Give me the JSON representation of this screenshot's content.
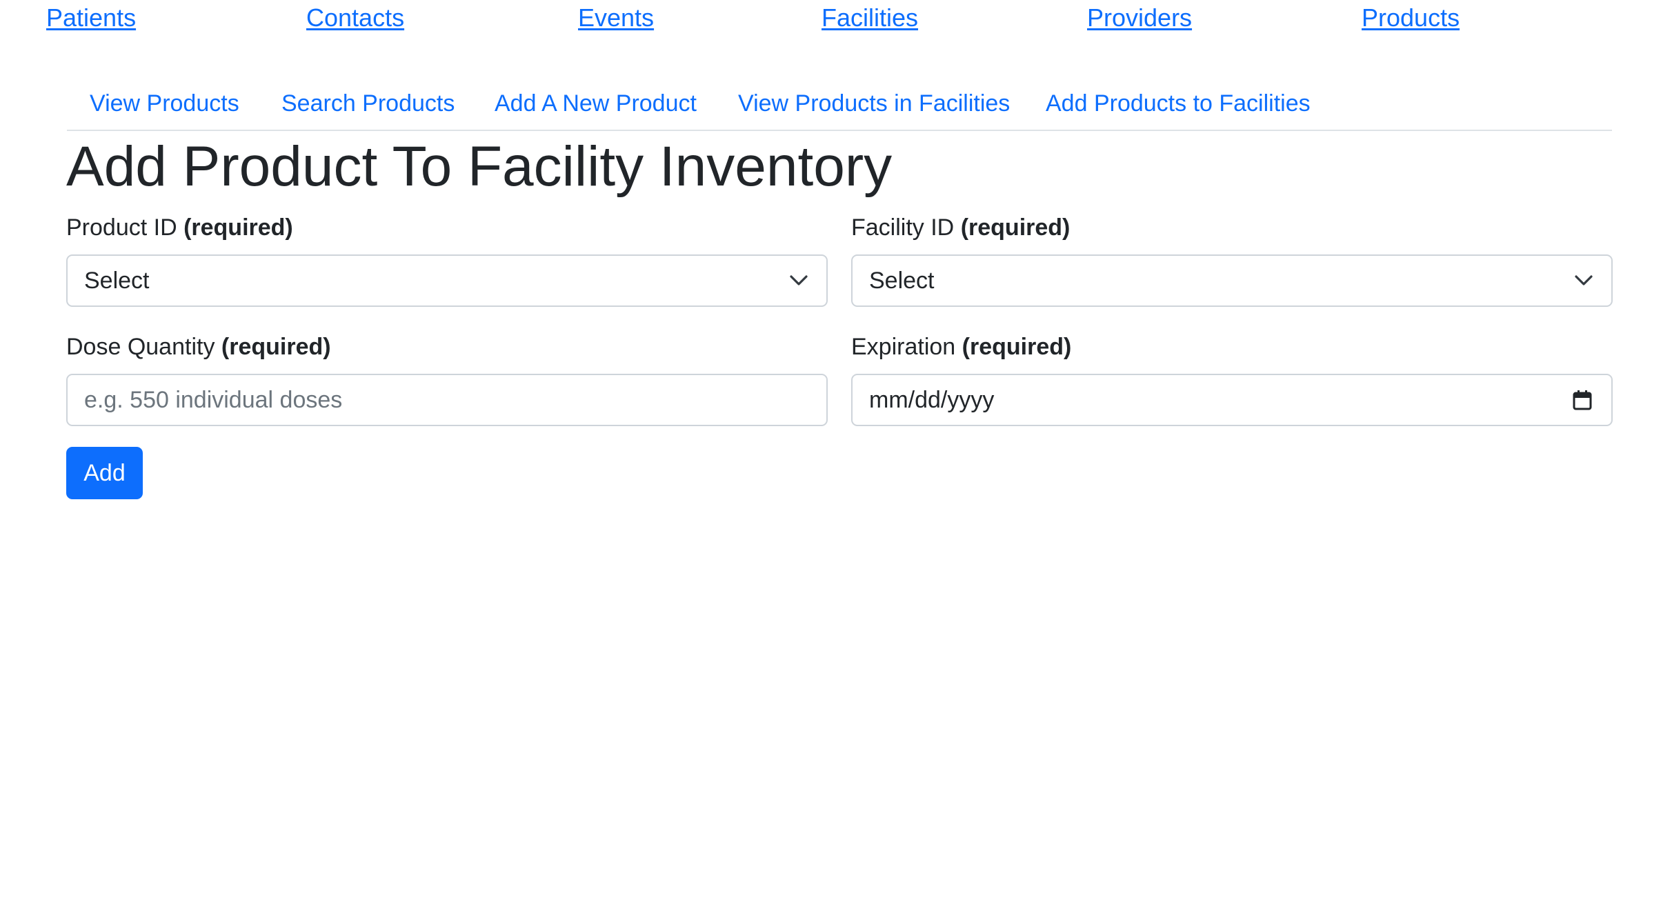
{
  "top_nav": {
    "patients": "Patients",
    "contacts": "Contacts",
    "events": "Events",
    "facilities": "Facilities",
    "providers": "Providers",
    "products": "Products"
  },
  "sub_nav": {
    "view_products": "View Products",
    "search_products": "Search Products",
    "add_new_product": "Add A New Product",
    "view_in_facilities": "View Products in Facilities",
    "add_to_facilities": "Add Products to Facilities"
  },
  "page": {
    "title": "Add Product To Facility Inventory"
  },
  "form": {
    "required_tag": "(required)",
    "product_id": {
      "label": "Product ID",
      "value": "Select"
    },
    "facility_id": {
      "label": "Facility ID",
      "value": "Select"
    },
    "dose_quantity": {
      "label": "Dose Quantity",
      "value": "",
      "placeholder": "e.g. 550 individual doses"
    },
    "expiration": {
      "label": "Expiration",
      "value": "mm/dd/yyyy"
    },
    "submit_label": "Add"
  },
  "icons": {
    "select_arrow": "chevron-down-icon",
    "date_picker": "calendar-icon"
  },
  "colors": {
    "link": "#0d6efd",
    "primary_button": "#0d6efd",
    "text": "#212529",
    "border": "#ced4da",
    "placeholder": "#6c757d"
  }
}
